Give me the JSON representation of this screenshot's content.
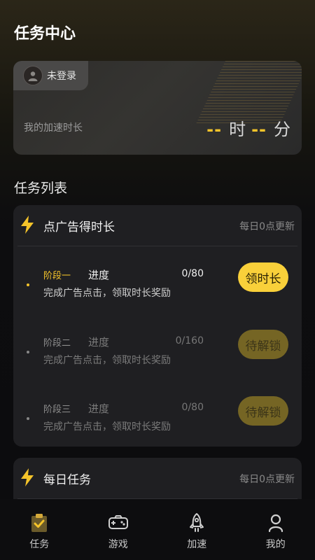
{
  "header": {
    "title": "任务中心"
  },
  "account": {
    "login_status": "未登录",
    "time_label": "我的加速时长",
    "hours_value": "--",
    "hours_unit": "时",
    "minutes_value": "--",
    "minutes_unit": "分"
  },
  "task_list": {
    "title": "任务列表",
    "ad_card": {
      "title": "点广告得时长",
      "subtitle": "每日0点更新",
      "stages": [
        {
          "name": "阶段一",
          "progress_label": "进度",
          "progress": "0/80",
          "description": "完成广告点击，领取时长奖励",
          "button": "领时长",
          "state": "active"
        },
        {
          "name": "阶段二",
          "progress_label": "进度",
          "progress": "0/160",
          "description": "完成广告点击，领取时长奖励",
          "button": "待解锁",
          "state": "locked"
        },
        {
          "name": "阶段三",
          "progress_label": "进度",
          "progress": "0/80",
          "description": "完成广告点击，领取时长奖励",
          "button": "待解锁",
          "state": "locked"
        }
      ]
    },
    "daily_card": {
      "title": "每日任务",
      "subtitle": "每日0点更新"
    }
  },
  "tabbar": {
    "items": [
      {
        "label": "任务",
        "icon": "task-clipboard-icon",
        "active": true
      },
      {
        "label": "游戏",
        "icon": "gamepad-icon",
        "active": false
      },
      {
        "label": "加速",
        "icon": "rocket-icon",
        "active": false
      },
      {
        "label": "我的",
        "icon": "profile-icon",
        "active": false
      }
    ]
  },
  "colors": {
    "accent": "#f9d03a",
    "locked_button": "#756524",
    "card_bg": "#1f1f22",
    "page_bg": "#0c0c0e"
  }
}
